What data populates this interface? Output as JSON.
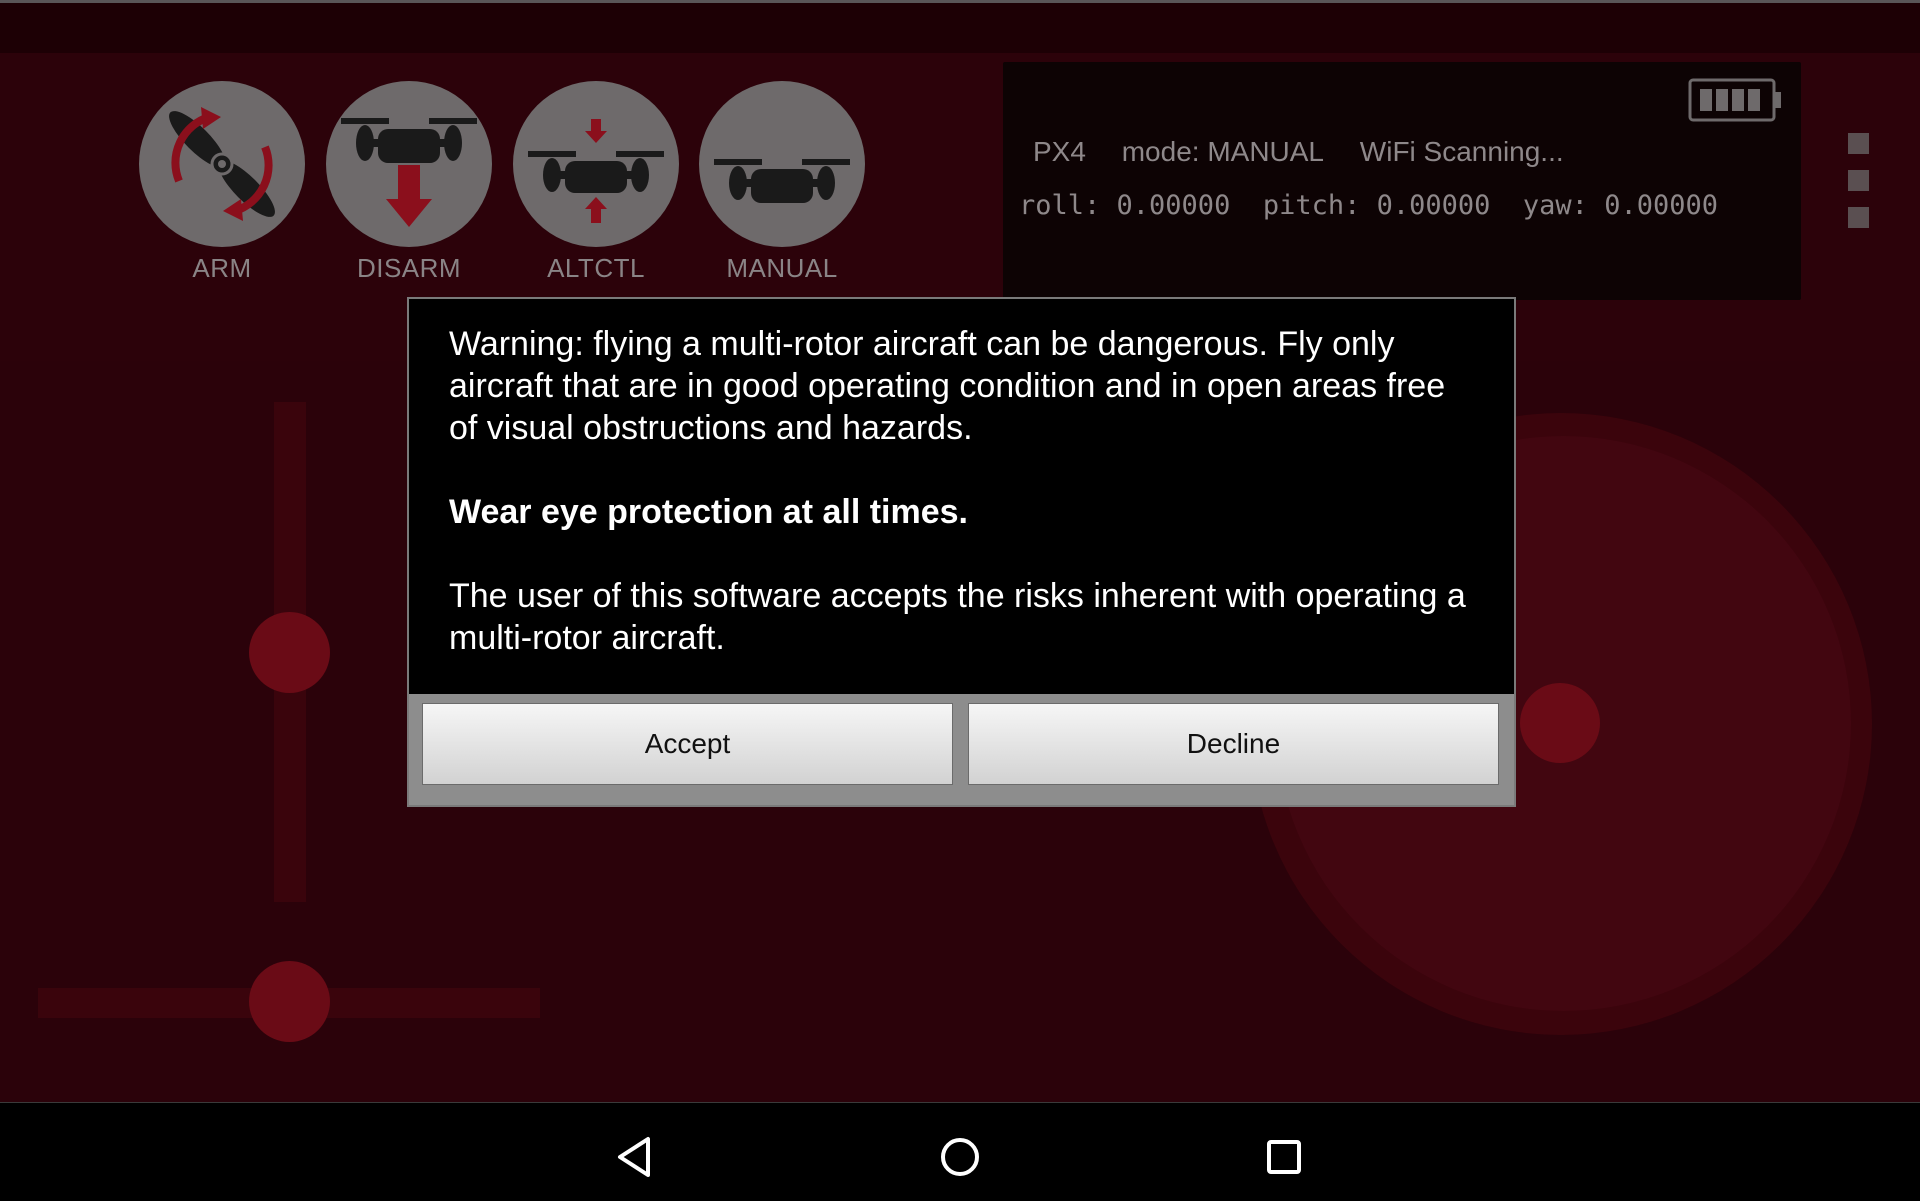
{
  "toolbar": {
    "modes": [
      {
        "label": "ARM",
        "icon": "propeller-icon"
      },
      {
        "label": "DISARM",
        "icon": "drone-down-arrow-icon"
      },
      {
        "label": "ALTCTL",
        "icon": "drone-altitude-hold-icon"
      },
      {
        "label": "MANUAL",
        "icon": "drone-icon"
      }
    ]
  },
  "telemetry": {
    "vehicle": "PX4",
    "mode": "mode: MANUAL",
    "wifi": "WiFi Scanning...",
    "attitude": "roll: 0.00000  pitch: 0.00000  yaw: 0.00000",
    "battery_icon": "battery-full-icon"
  },
  "dialog": {
    "paragraph1": "Warning: flying a multi-rotor aircraft can be dangerous. Fly only aircraft that are in good operating condition and in open areas free of visual obstructions and hazards.",
    "paragraph2": "Wear eye protection at all times.",
    "paragraph3": "The user of this software accepts the risks inherent with operating a multi-rotor aircraft.",
    "accept_label": "Accept",
    "decline_label": "Decline"
  },
  "nav": {
    "back_icon": "back-triangle-icon",
    "home_icon": "home-circle-icon",
    "recents_icon": "recents-square-icon"
  },
  "colors": {
    "background": "#2b020a",
    "accent_red": "#8b0f1c",
    "dialog_bg": "#000000"
  }
}
